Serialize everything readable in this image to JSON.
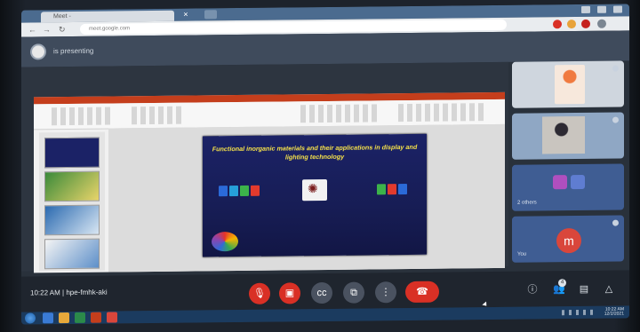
{
  "browser": {
    "tab_title": "Meet - ",
    "url": "meet.google.com"
  },
  "meeting": {
    "presenting_text": "is presenting",
    "time": "10:22 AM",
    "separator": "|",
    "meeting_code": "hpe-fmhk-aki"
  },
  "slide": {
    "title": "Functional inorganic materials and their applications in display and lighting technology",
    "author_line1": "",
    "author_line2": "",
    "author_line3": ""
  },
  "participants": {
    "self_initial": "m",
    "others_label": "others",
    "others_count": "2",
    "you_label": "You"
  },
  "controls": {
    "mic_icon": "mic-off-icon",
    "camera_icon": "videocam-off-icon",
    "captions_icon": "captions-icon",
    "present_icon": "present-icon",
    "more_icon": "more-vert-icon",
    "end_icon": "call-end-icon",
    "people_badge": "4"
  },
  "taskbar": {
    "time": "10:22 AM",
    "date": "12/2/2021"
  },
  "colors": {
    "accent_red": "#d93025",
    "tile_blue": "#3f5d93",
    "slide_bg": "#1b2266",
    "slide_title": "#f5e14a"
  }
}
